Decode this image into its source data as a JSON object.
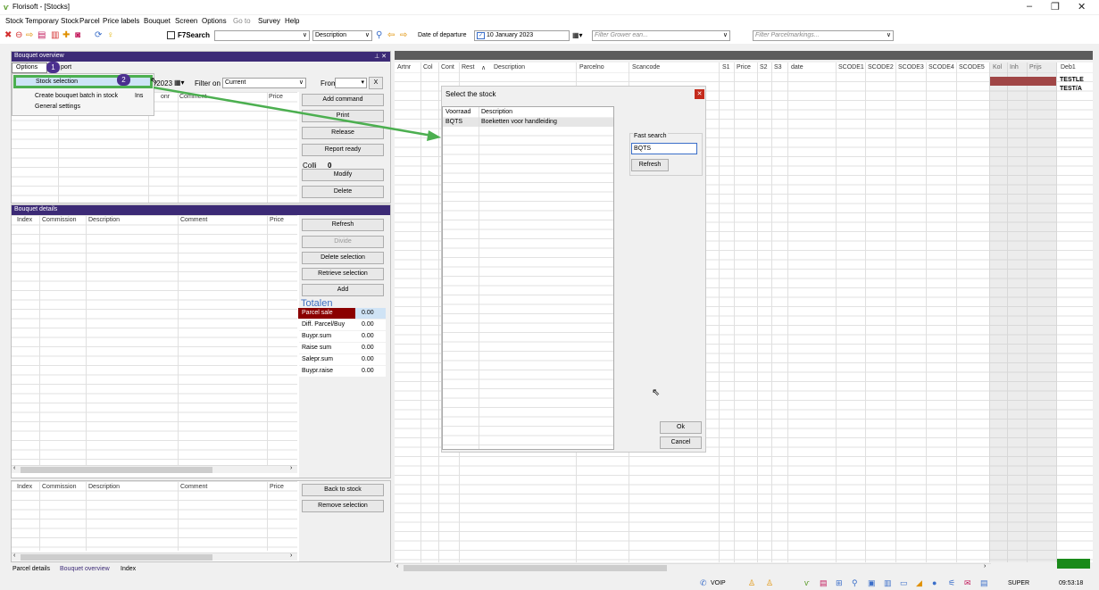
{
  "window": {
    "title": "Florisoft - [Stocks]",
    "min": "–",
    "max": "❐",
    "close": "✕"
  },
  "menu": [
    "Stock",
    "Temporary Stock",
    "Parcel",
    "Price labels",
    "Bouquet",
    "Screen",
    "Options",
    "Go to",
    "Survey",
    "Help"
  ],
  "toolbar": {
    "f7search_label": "F7Search",
    "search_value": "",
    "filter_field": "Description",
    "date_label": "Date of departure",
    "date_value": "10  January  2023",
    "grower_placeholder": "Filter Grower ean...",
    "parcelmarkings_placeholder": "Filter Parcelmarkings..."
  },
  "bouquet_overview": {
    "title": "Bouquet overview",
    "pin": "⊥ ✕",
    "date_fragment": "/2023",
    "filter_on_label": "Filter on",
    "filter_on_value": "Current",
    "from_label": "From",
    "clear_btn": "X",
    "columns": {
      "nr": "onr",
      "comment": "Comment",
      "price": "Price"
    },
    "buttons": [
      "Add command",
      "Print",
      "Release",
      "Report ready"
    ],
    "colli_label": "Colli",
    "colli_value": "0",
    "modify": "Modify",
    "delete": "Delete"
  },
  "options_menu": {
    "tab_options": "Options",
    "tab_hidden": "port",
    "items": [
      {
        "label": "Stock selection",
        "shortcut": ""
      },
      {
        "label": "Create bouquet batch in stock",
        "shortcut": "Ins"
      },
      {
        "label": "General settings",
        "shortcut": ""
      }
    ],
    "callouts": [
      "1",
      "2"
    ]
  },
  "bouquet_details": {
    "title": "Bouquet details",
    "columns": [
      "Index",
      "Commission",
      "Description",
      "Comment",
      "Price"
    ],
    "buttons": [
      "Refresh",
      "Divide",
      "Delete selection",
      "Retrieve selection",
      "Add"
    ],
    "totals_title": "Totalen",
    "totals": [
      {
        "label": "Parcel sale",
        "value": "0.00"
      },
      {
        "label": "Diff. Parcel/Buy",
        "value": "0.00"
      },
      {
        "label": "Buypr.sum",
        "value": "0.00"
      },
      {
        "label": "Raise sum",
        "value": "0.00"
      },
      {
        "label": "Salepr.sum",
        "value": "0.00"
      },
      {
        "label": "Buypr.raise",
        "value": "0.00"
      }
    ]
  },
  "selection_panel": {
    "columns": [
      "Index",
      "Commission",
      "Description",
      "Comment",
      "Price"
    ],
    "buttons": [
      "Back to stock",
      "Remove selection"
    ]
  },
  "bottom_tabs": [
    "Parcel details",
    "Bouquet overview",
    "Index"
  ],
  "stock_grid": {
    "columns": [
      "Artnr",
      "Col",
      "Cont",
      "Rest",
      "Description",
      "Parcelno",
      "Scancode",
      "S1",
      "Price",
      "S2",
      "S3",
      "date",
      "SCODE1",
      "SCODE2",
      "SCODE3",
      "SCODE4",
      "SCODE5",
      "Kol",
      "Inh",
      "Prijs",
      "Deb1"
    ],
    "deb_values": [
      "TESTLE",
      "TEST/A"
    ]
  },
  "dialog": {
    "title": "Select the stock",
    "columns": [
      "Voorraad",
      "Description"
    ],
    "rows": [
      {
        "code": "BQTS",
        "description": "Boeketten voor handleiding"
      }
    ],
    "fast_search_label": "Fast search",
    "fast_search_value": "BQTS",
    "refresh": "Refresh",
    "ok": "Ok",
    "cancel": "Cancel"
  },
  "status": {
    "voip": "VOIP",
    "user": "SUPER",
    "time": "09:53:18"
  },
  "colors": {
    "header": "#3c2a76",
    "callout": "#4b2f8f",
    "arrow": "#4caf50",
    "dark_red": "#8b0000",
    "status_green": "#1a8a1a"
  }
}
